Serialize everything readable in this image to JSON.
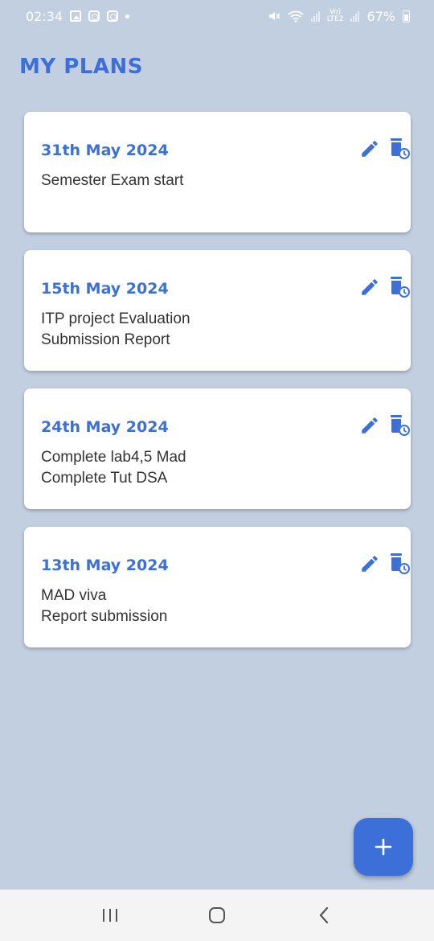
{
  "status_bar": {
    "time": "02:34",
    "lte_top": "Vo)",
    "lte_bottom": "LTE2",
    "battery": "67%"
  },
  "page": {
    "title": "MY PLANS"
  },
  "colors": {
    "accent": "#3c6fd7",
    "background": "#c2cfe1",
    "card": "#ffffff"
  },
  "plans": [
    {
      "date": "31th May 2024",
      "text": "Semester Exam start"
    },
    {
      "date": "15th May 2024",
      "text": "ITP project Evaluation\nSubmission Report"
    },
    {
      "date": "24th May 2024",
      "text": "Complete lab4,5 Mad\nComplete Tut DSA"
    },
    {
      "date": "13th May 2024",
      "text": "MAD viva\nReport submission"
    }
  ],
  "icons": {
    "edit": "pencil-icon",
    "delete": "delete-clock-icon",
    "fab": "plus-icon",
    "nav": [
      "recent-apps-icon",
      "home-icon",
      "back-icon"
    ]
  }
}
